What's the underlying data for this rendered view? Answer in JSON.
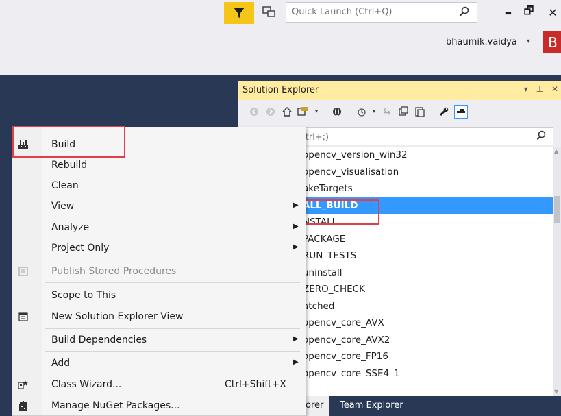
{
  "titlebar": {
    "quick_launch_placeholder": "Quick Launch (Ctrl+Q)",
    "user_name": "bhaumik.vaidya",
    "user_caret": "▾",
    "avatar_letter": "B",
    "minimize_glyph": "▬",
    "restore_glyph": "🗗",
    "close_glyph": "✕",
    "filter_color": "#f5c518"
  },
  "solution_explorer": {
    "title": "Solution Explorer",
    "header_icons": [
      "▾",
      "⊥",
      "✕"
    ],
    "search_placeholder": "on Explorer (Ctrl+;)",
    "items": [
      {
        "label": "opencv_version_win32",
        "selected": false
      },
      {
        "label": "opencv_visualisation",
        "selected": false
      },
      {
        "label": "akeTargets",
        "selected": false
      },
      {
        "label": "ALL_BUILD",
        "selected": true
      },
      {
        "label": "NSTALL",
        "selected": false
      },
      {
        "label": "PACKAGE",
        "selected": false
      },
      {
        "label": "RUN_TESTS",
        "selected": false
      },
      {
        "label": "uninstall",
        "selected": false
      },
      {
        "label": "ZERO_CHECK",
        "selected": false
      },
      {
        "label": "atched",
        "selected": false
      },
      {
        "label": "opencv_core_AVX",
        "selected": false
      },
      {
        "label": "opencv_core_AVX2",
        "selected": false
      },
      {
        "label": "opencv_core_FP16",
        "selected": false
      },
      {
        "label": "opencv_core_SSE4_1",
        "selected": false
      }
    ],
    "tabs": {
      "explorer_tab": "orer",
      "team_tab": "Team Explorer"
    },
    "selection_color": "#3399ff"
  },
  "context_menu": {
    "build": "Build",
    "rebuild": "Rebuild",
    "clean": "Clean",
    "view": "View",
    "analyze": "Analyze",
    "project_only": "Project Only",
    "publish": "Publish Stored Procedures",
    "scope": "Scope to This",
    "new_se_view": "New Solution Explorer View",
    "build_deps": "Build Dependencies",
    "add": "Add",
    "class_wizard": "Class Wizard...",
    "class_wizard_shortcut": "Ctrl+Shift+X",
    "nuget": "Manage NuGet Packages...",
    "submenu_arrow": "▶"
  },
  "highlight_color": "#e0404a"
}
